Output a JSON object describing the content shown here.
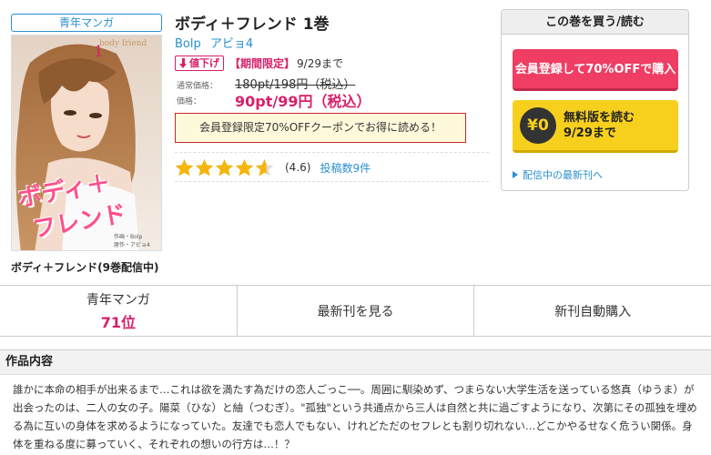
{
  "genre_tag": "青年マンガ",
  "cover": {
    "vol_number": "1",
    "logo_text": "body friend",
    "title_line1": "ボディ＋",
    "title_line2": "フレンド",
    "credit_line1": "作画・Bolp",
    "credit_line2": "原作・アビョ4"
  },
  "cover_caption": "ボディ＋フレンド(9巻配信中)",
  "title": "ボディ＋フレンド 1巻",
  "authors": [
    "Bolp",
    "アビョ4"
  ],
  "sale": {
    "price_down": "値下げ",
    "limited": "【期間限定】",
    "until": "9/29まで"
  },
  "pricing": {
    "regular_label": "通常価格：",
    "regular_price": "180pt/198円（税込）",
    "current_label": "価格：",
    "current_price": "90pt/99円（税込）"
  },
  "coupon": "会員登録限定70%OFFクーポンでお得に読める！",
  "rating": {
    "stars": 4.6,
    "value_text": "(4.6)",
    "review_link": "投稿数9件"
  },
  "buybox": {
    "header": "この巻を買う/読む",
    "member_button": "会員登録して70%OFFで購入",
    "zero_badge": "¥0",
    "free_line1": "無料版を読む",
    "free_line2": "9/29まで",
    "latest_link": "配信中の最新刊へ"
  },
  "tabs": {
    "genre_label": "青年マンガ",
    "rank": "71位",
    "latest": "最新刊を見る",
    "auto_buy": "新刊自動購入"
  },
  "description": {
    "heading": "作品内容",
    "text": "誰かに本命の相手が出来るまで…これは欲を満たす為だけの恋人ごっこ──。周囲に馴染めず、つまらない大学生活を送っている悠真（ゆうま）が出会ったのは、二人の女の子。陽菜（ひな）と紬（つむぎ）。\"孤独\"という共通点から三人は自然と共に過ごすようになり、次第にその孤独を埋める為に互いの身体を求めるようになっていた。友達でも恋人でもない、けれどただのセフレとも割り切れない…どこかやるせなく危うい関係。身体を重ねる度に募っていく、それぞれの想いの行方は…！？"
  },
  "colors": {
    "accent_pink": "#d8206a",
    "link_blue": "#2a8fd0",
    "buy_red": "#ef3d63",
    "free_yellow": "#f7d01e",
    "star_yellow": "#f5b50a"
  }
}
